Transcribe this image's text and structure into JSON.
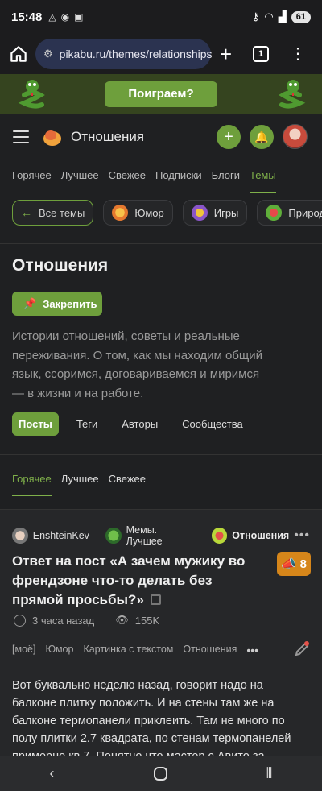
{
  "status": {
    "time": "15:48",
    "left_icons": [
      "vpn-icon",
      "shield-icon",
      "camera-icon",
      "media-icon"
    ],
    "right_icons": [
      "key-icon",
      "wifi-icon",
      "signal-icon"
    ],
    "battery": "61"
  },
  "browser": {
    "url": "pikabu.ru/themes/relationships",
    "tab_count": "1"
  },
  "banner": {
    "play_label": "Поиграем?"
  },
  "header": {
    "title": "Отношения"
  },
  "nav": {
    "tabs": [
      {
        "label": "Горячее"
      },
      {
        "label": "Лучшее"
      },
      {
        "label": "Свежее"
      },
      {
        "label": "Подписки"
      },
      {
        "label": "Блоги"
      },
      {
        "label": "Темы"
      }
    ],
    "active": "Темы"
  },
  "chips": {
    "back_label": "Все темы",
    "items": [
      {
        "label": "Юмор"
      },
      {
        "label": "Игры"
      },
      {
        "label": "Природ"
      }
    ]
  },
  "theme": {
    "title": "Отношения",
    "pin_label": "Закрепить",
    "description": "Истории отношений, советы и реальные переживания. О том, как мы находим общий язык, ссоримся, договариваемся и миримся — в жизни и на работе."
  },
  "subtabs": {
    "items": [
      {
        "label": "Посты"
      },
      {
        "label": "Теги"
      },
      {
        "label": "Авторы"
      },
      {
        "label": "Сообщества"
      }
    ],
    "active": "Посты"
  },
  "sort": {
    "items": [
      {
        "label": "Горячее"
      },
      {
        "label": "Лучшее"
      },
      {
        "label": "Свежее"
      }
    ],
    "active": "Горячее"
  },
  "post": {
    "author": "EnshteinKev",
    "community": "Мемы. Лучшее",
    "theme": "Отношения",
    "title": "Ответ на пост «А зачем мужику во френдзоне что-то делать без прямой просьбы?»",
    "rating": "8",
    "time_ago": "3 часа назад",
    "views": "155K",
    "tags": [
      "[моё]",
      "Юмор",
      "Картинка с текстом",
      "Отношения"
    ],
    "text": "Вот буквально неделю назад, говорит надо на балконе плитку положить. И на стены там же на балконе термопанели приклеить. Там не много по полу плитки 2.7 квадрата, по стенам термопанелей примерно кв 7. Понятно что мастер с Авито за"
  },
  "colors": {
    "accent": "#6e9f3c",
    "accent_text": "#7fb04a",
    "rating": "#d6861a",
    "background": "#1f2022",
    "banner": "#35441f"
  }
}
